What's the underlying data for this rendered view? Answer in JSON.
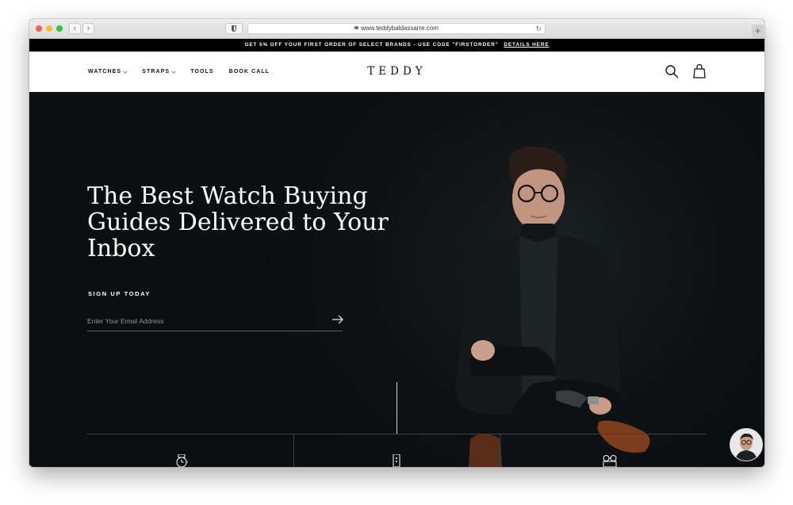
{
  "browser": {
    "url": "www.teddybaldassarre.com",
    "back_icon": "‹",
    "forward_icon": "›",
    "reload_icon": "↻",
    "new_tab_icon": "+"
  },
  "promo": {
    "text": "GET 5% OFF YOUR FIRST ORDER OF SELECT BRANDS - USE CODE \"FIRSTORDER\"",
    "link_label": "DETAILS HERE"
  },
  "nav": {
    "items": [
      {
        "label": "WATCHES",
        "has_dropdown": true
      },
      {
        "label": "STRAPS",
        "has_dropdown": true
      },
      {
        "label": "TOOLS",
        "has_dropdown": false
      },
      {
        "label": "BOOK CALL",
        "has_dropdown": false
      }
    ],
    "logo": "TEDDY",
    "search_icon": "search-icon",
    "cart_icon": "shopping-bag-icon"
  },
  "hero": {
    "headline": "The Best Watch Buying Guides Delivered to Your Inbox",
    "signup_label": "SIGN UP TODAY",
    "email_placeholder": "Enter Your Email Address",
    "submit_icon": "arrow-right-icon"
  },
  "features": [
    {
      "icon": "watch-icon"
    },
    {
      "icon": "watch-strap-icon"
    },
    {
      "icon": "glasses-icon"
    }
  ],
  "chat": {
    "icon": "chat-avatar"
  },
  "colors": {
    "hero_background": "#0d1012",
    "promo_background": "#000000",
    "nav_background": "#ffffff",
    "text_light": "#ffffff"
  }
}
